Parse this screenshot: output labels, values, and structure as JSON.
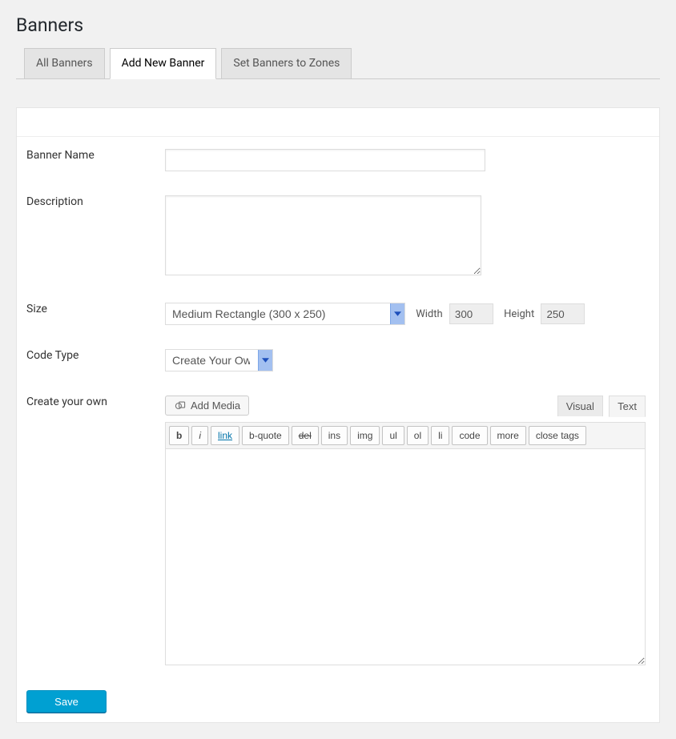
{
  "page_title": "Banners",
  "tabs": [
    {
      "label": "All Banners",
      "active": false
    },
    {
      "label": "Add New Banner",
      "active": true
    },
    {
      "label": "Set Banners to Zones",
      "active": false
    }
  ],
  "form": {
    "banner_name": {
      "label": "Banner Name",
      "value": ""
    },
    "description": {
      "label": "Description",
      "value": ""
    },
    "size": {
      "label": "Size",
      "selected": "Medium Rectangle (300 x 250)",
      "width_label": "Width",
      "width_value": "300",
      "height_label": "Height",
      "height_value": "250"
    },
    "code_type": {
      "label": "Code Type",
      "selected": "Create Your Own"
    },
    "create_own": {
      "label": "Create your own"
    }
  },
  "editor": {
    "add_media_label": "Add Media",
    "tabs": {
      "visual": "Visual",
      "text": "Text",
      "active": "text"
    },
    "quicktags": [
      "b",
      "i",
      "link",
      "b-quote",
      "del",
      "ins",
      "img",
      "ul",
      "ol",
      "li",
      "code",
      "more",
      "close tags"
    ],
    "content": ""
  },
  "actions": {
    "save_label": "Save"
  }
}
